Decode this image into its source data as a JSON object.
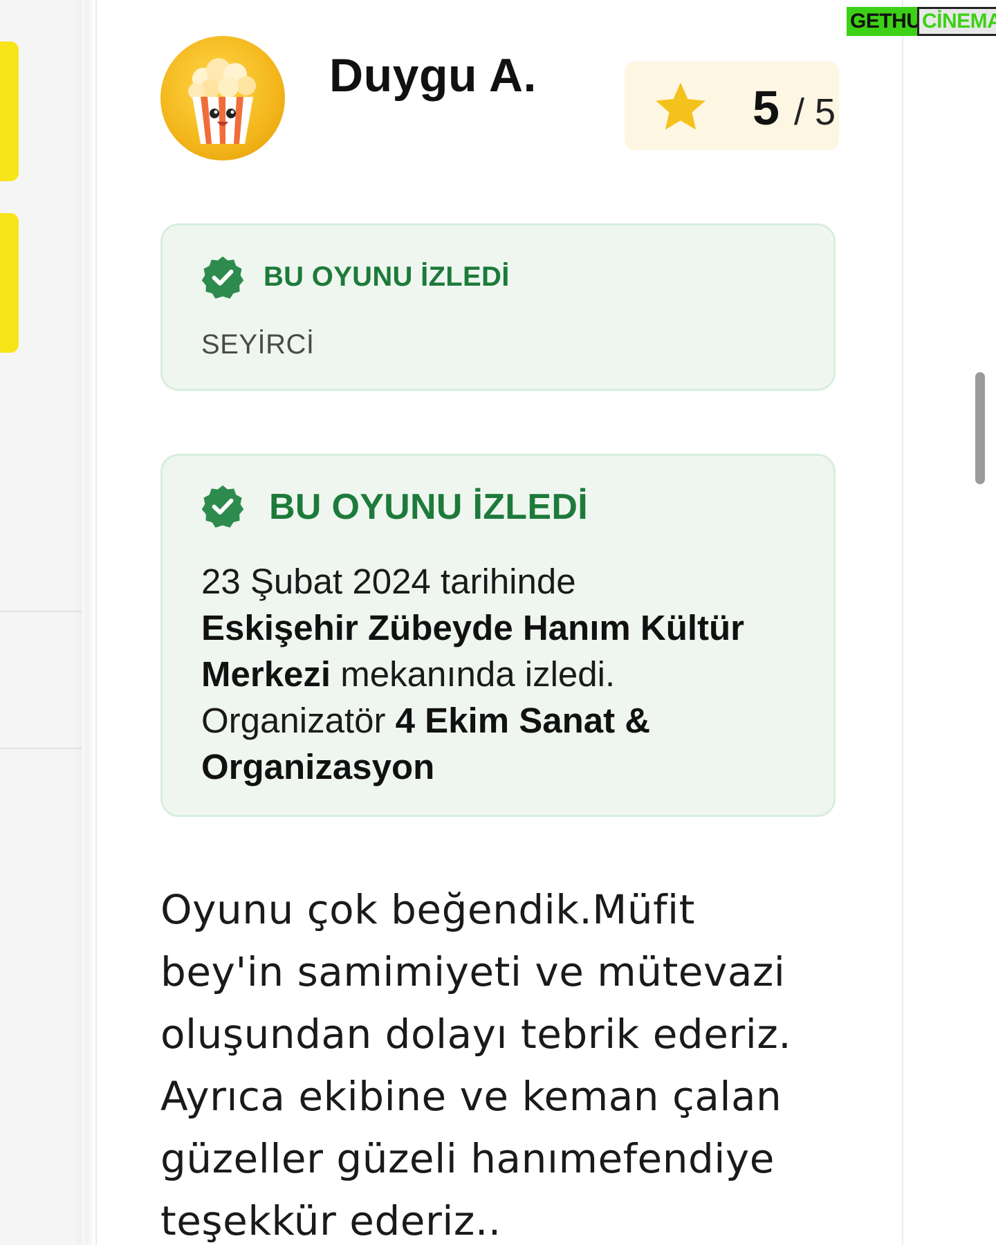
{
  "watermark": {
    "part1": "GETHU",
    "part2": "CİNEMA"
  },
  "review": {
    "avatar_icon": "popcorn-avatar",
    "user_name": "Duygu A.",
    "rating": {
      "value": "5",
      "separator": "/ 5",
      "icon": "star-icon"
    },
    "audience_badge": {
      "label": "BU OYUNU İZLEDİ",
      "role": "SEYİRCİ"
    },
    "event_badge": {
      "label": "BU OYUNU İZLEDİ",
      "date_text": "23 Şubat 2024 tarihinde",
      "venue": "Eskişehir Zübeyde Hanım Kültür Merkezi",
      "venue_suffix": " mekanında izledi.",
      "organizer_prefix": "Organizatör ",
      "organizer": "4 Ekim Sanat & Organizasyon"
    },
    "comment_lines": [
      "Oyunu çok beğendik.Müfit",
      "bey'in samimiyeti ve mütevazi",
      "oluşundan dolayı tebrik ederiz.",
      "Ayrıca ekibine ve keman çalan",
      "güzeller güzeli hanımefendiye",
      "teşekkür ederiz.."
    ]
  },
  "colors": {
    "accent_green": "#1d7a3a",
    "badge_bg": "#eff6f0",
    "rating_bg": "#fdf6e3",
    "star": "#f4c21d",
    "tab_yellow": "#f7e51a"
  }
}
